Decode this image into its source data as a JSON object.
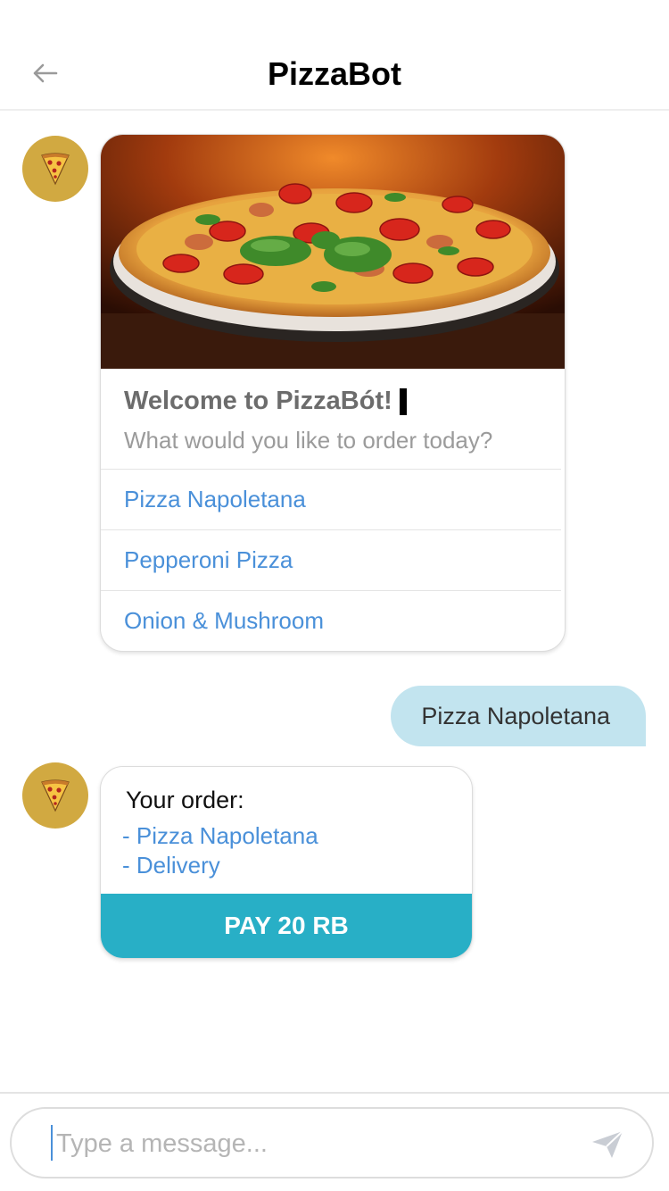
{
  "header": {
    "title": "PizzaBot",
    "back_icon": "arrow-left-icon"
  },
  "messages": {
    "bot_avatar_icon": "pizza-slice-icon",
    "welcome_card": {
      "image": "pizza-photo",
      "title": "Welcome to PizzaBót!",
      "subtitle": "What would you like to order today?",
      "options": [
        {
          "label": "Pizza Napoletana"
        },
        {
          "label": "Pepperoni Pizza"
        },
        {
          "label": "Onion & Mushroom"
        }
      ]
    },
    "user_reply": "Pizza Napoletana",
    "order_card": {
      "title": "Your order:",
      "lines": [
        "- Pizza Napoletana",
        "- Delivery"
      ],
      "pay_label": "PAY 20 RB"
    }
  },
  "composer": {
    "placeholder": "Type a message...",
    "send_icon": "send-icon"
  },
  "colors": {
    "avatar_bg": "#d1a941",
    "link_blue": "#4a90d9",
    "user_bubble": "#c2e4ef",
    "pay_button": "#28afc6"
  }
}
